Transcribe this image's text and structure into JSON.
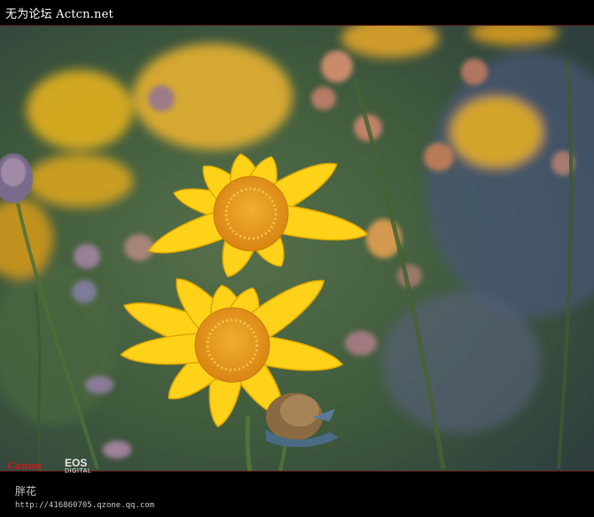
{
  "header": {
    "watermark": "无为论坛 Actcn.net"
  },
  "photo": {
    "subject": "yellow-daisies",
    "camera_brand": "Canon",
    "camera_model": "EOS",
    "camera_model_sub": "DIGITAL"
  },
  "footer": {
    "caption": "胖花",
    "url": "http://416860705.qzone.qq.com"
  },
  "colors": {
    "background": "#000000",
    "petal": "#ffd21a",
    "flower_center": "#e89a1a",
    "foliage": "#3b5236",
    "brand_red": "#d01818"
  }
}
